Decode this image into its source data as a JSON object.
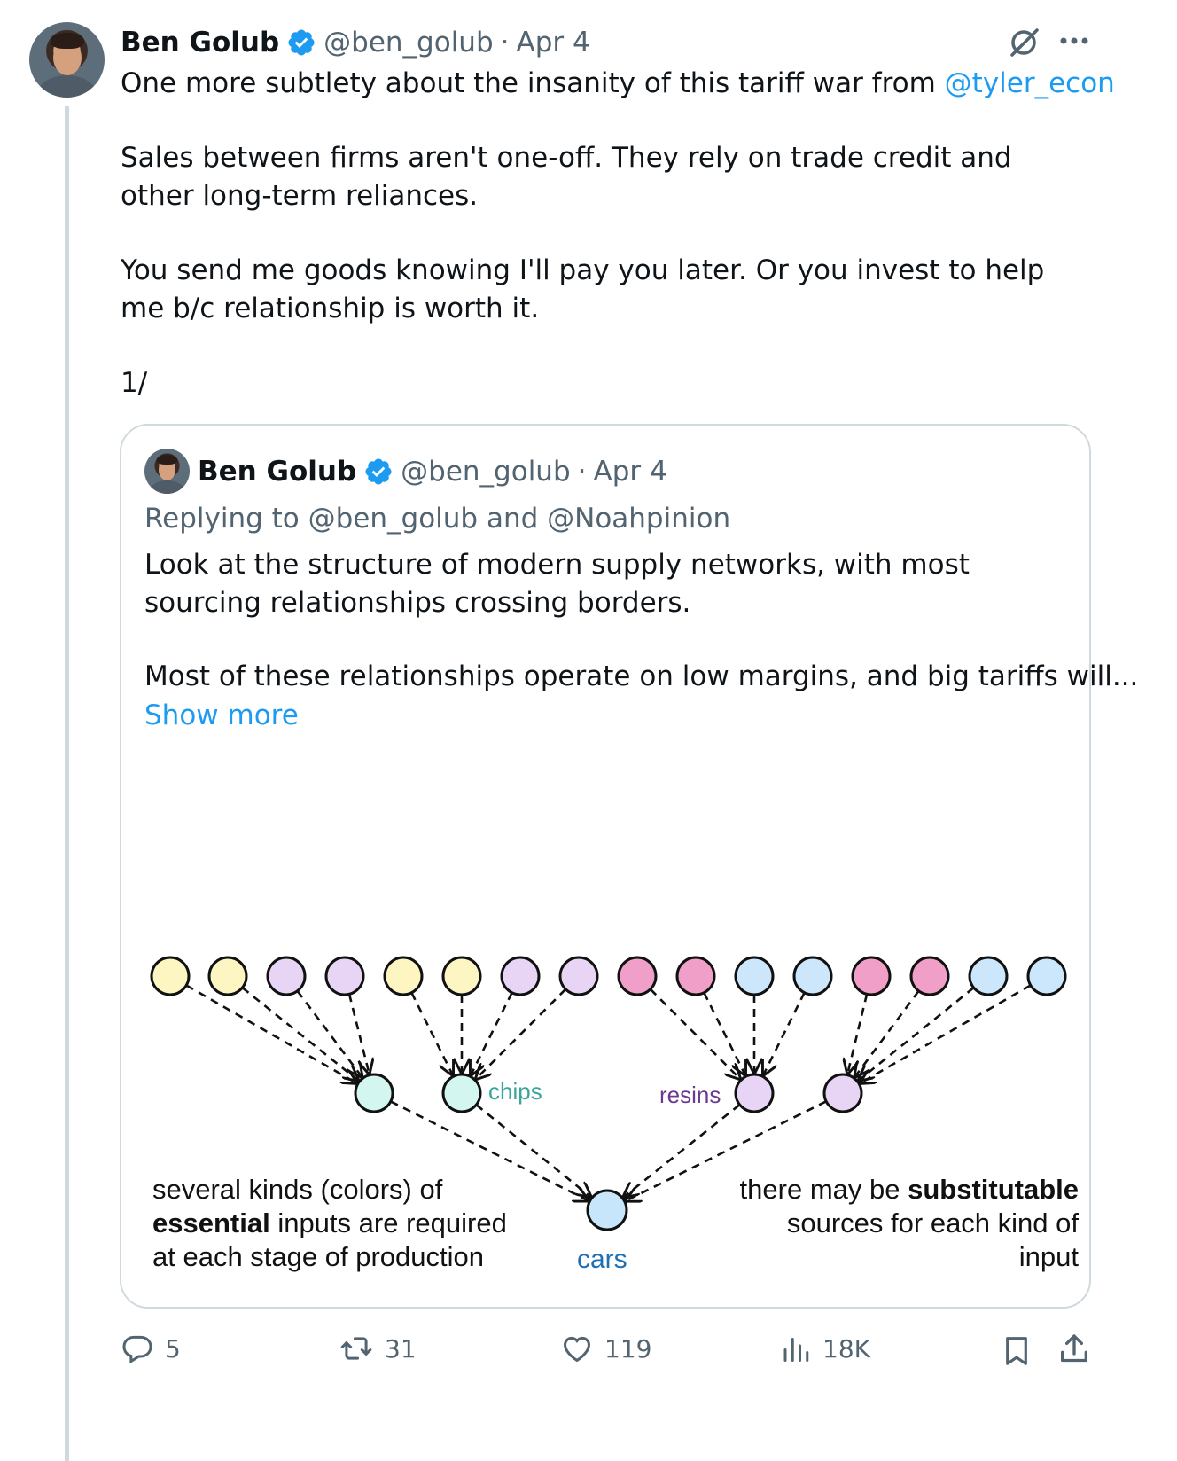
{
  "tweet": {
    "author_name": "Ben Golub",
    "handle": "@ben_golub",
    "date": "Apr 4",
    "separator": "·",
    "text_intro": "One more subtlety about the insanity of this tariff war from ",
    "mention": "@tyler_econ",
    "para2": "Sales between firms aren't one-off. They rely on trade credit and other long-term reliances.",
    "para3": "You send me goods knowing I'll pay you later. Or you invest to help me b/c relationship is worth it.",
    "para4": "1/"
  },
  "quote": {
    "author_name": "Ben Golub",
    "handle": "@ben_golub",
    "date": "Apr 4",
    "separator": "·",
    "replying_to": "Replying to @ben_golub and @Noahpinion",
    "para1": "Look at the structure of modern supply networks, with most sourcing relationships crossing borders.",
    "para2": "Most of these relationships operate on low margins, and big tariffs will...",
    "show_more": "Show more"
  },
  "diagram": {
    "label_chips": "chips",
    "label_resins": "resins",
    "label_cars": "cars",
    "left_caption": {
      "line1": "several kinds (colors) of",
      "line2_bold": "essential",
      "line2_rest": " inputs are required",
      "line3": "at each stage of production"
    },
    "right_caption": {
      "line1_pre": "there may be ",
      "line1_bold": "substitutable",
      "line2": "sources for each kind of",
      "line3": "input"
    },
    "colors": {
      "yellow": "#fdf6c3",
      "lavender": "#e8d5f5",
      "pink": "#f0a0c8",
      "blue": "#cce6fb",
      "mint": "#d3f7f0",
      "cars_blue": "#c8e6fb",
      "chips_text": "#3aa59a",
      "resins_text": "#6b3a8f",
      "cars_text": "#1f6fb5"
    }
  },
  "actions": {
    "replies": "5",
    "reposts": "31",
    "likes": "119",
    "views": "18K"
  },
  "icons": [
    "verified-badge-icon",
    "grok-icon",
    "more-icon",
    "reply-icon",
    "repost-icon",
    "like-icon",
    "views-icon",
    "bookmark-icon",
    "share-icon"
  ]
}
